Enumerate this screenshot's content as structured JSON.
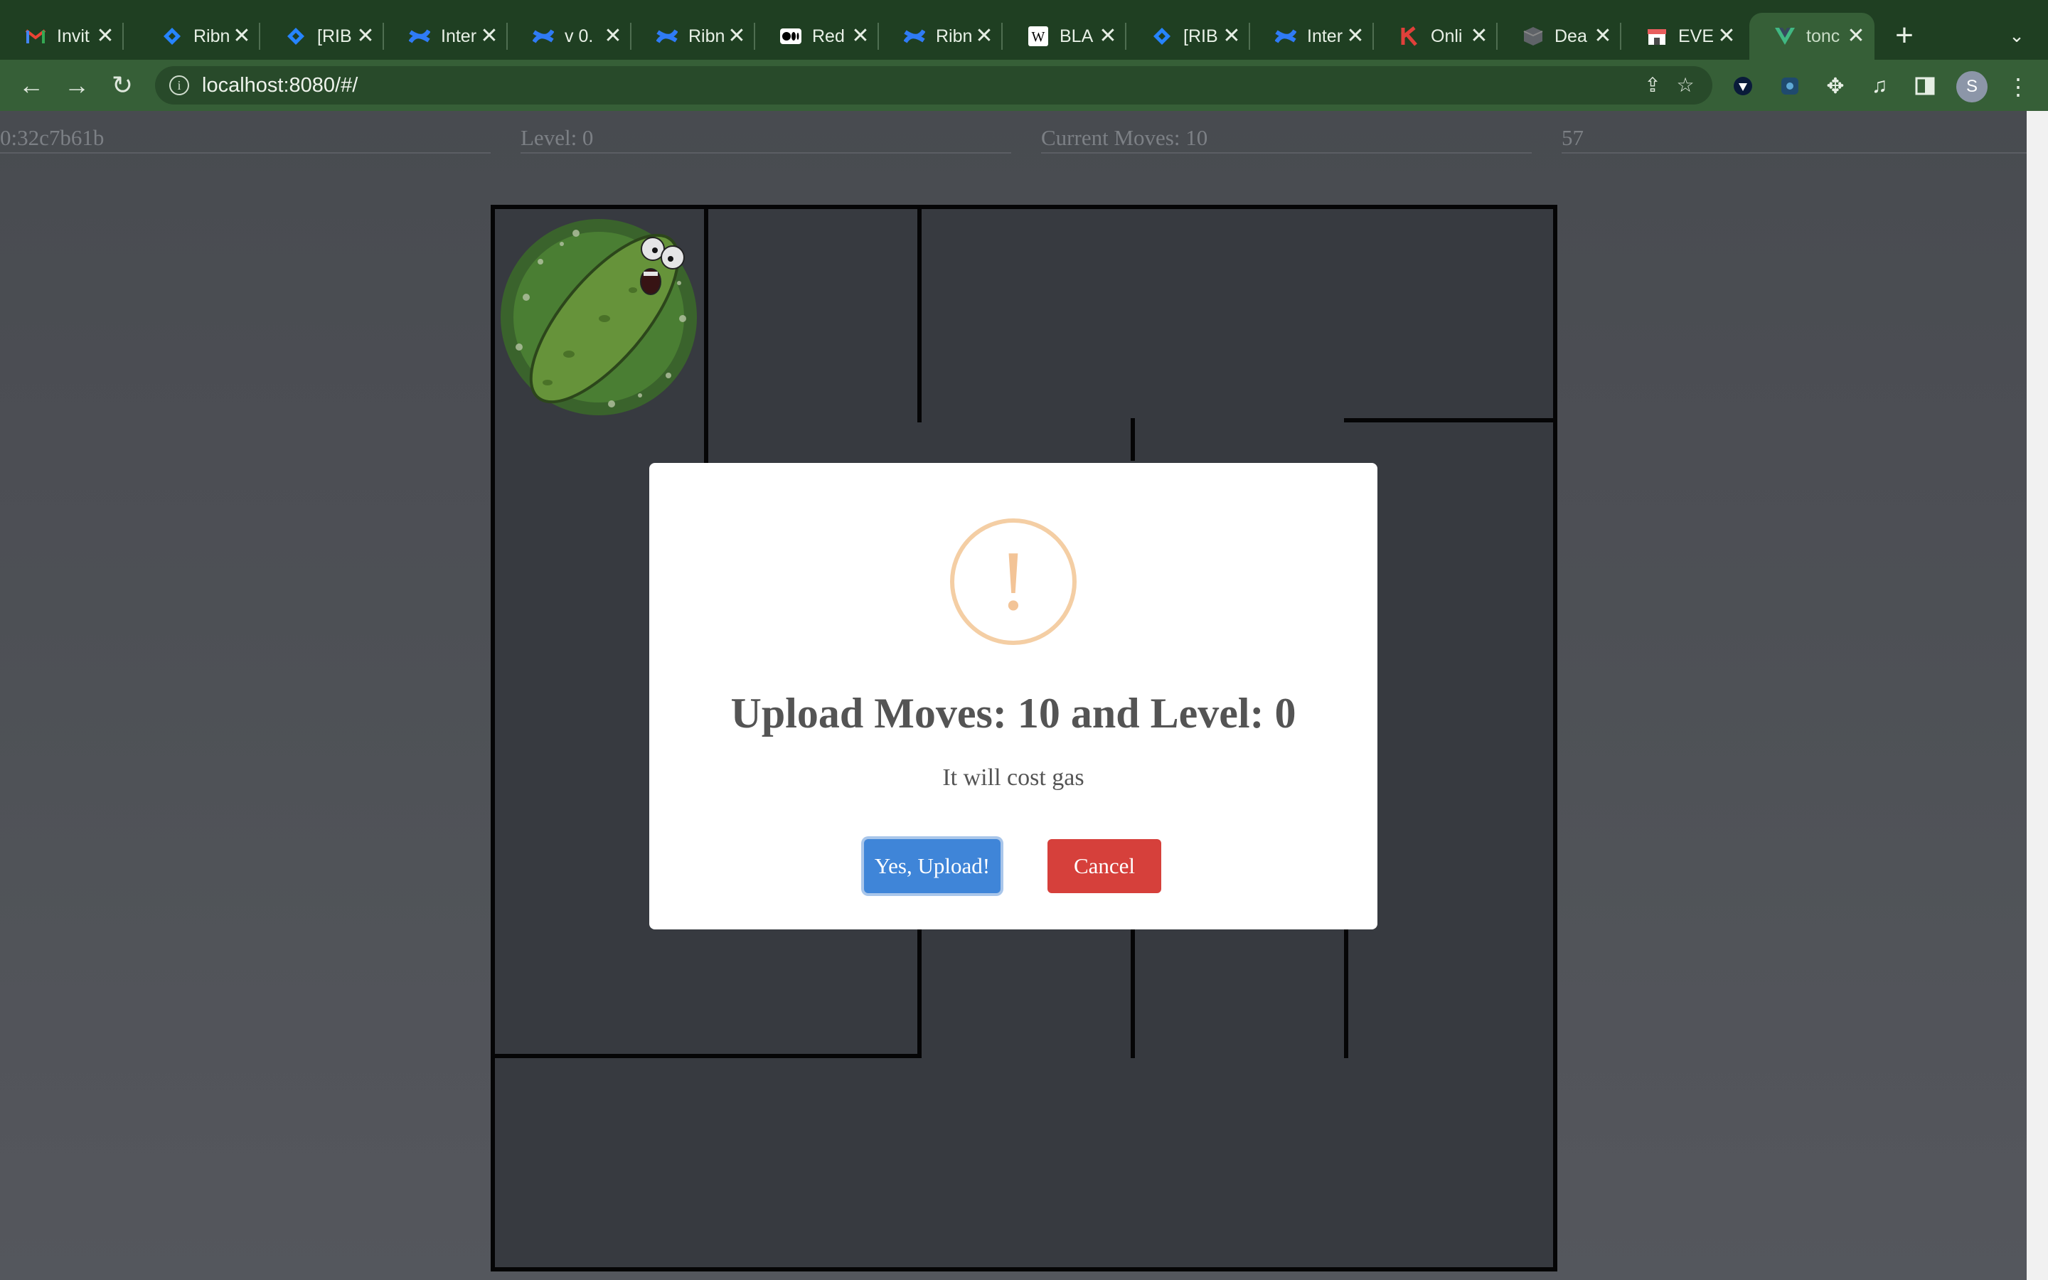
{
  "browser": {
    "tabs": [
      {
        "title": "Invit",
        "icon": "gmail-icon"
      },
      {
        "title": "Ribn",
        "icon": "jira-icon"
      },
      {
        "title": "[RIB",
        "icon": "jira-icon"
      },
      {
        "title": "Inter",
        "icon": "confluence-icon"
      },
      {
        "title": "v 0.",
        "icon": "confluence-icon"
      },
      {
        "title": "Ribn",
        "icon": "confluence-icon"
      },
      {
        "title": "Red",
        "icon": "medium-icon"
      },
      {
        "title": "Ribn",
        "icon": "confluence-icon"
      },
      {
        "title": "BLA",
        "icon": "wikipedia-icon"
      },
      {
        "title": "[RIB",
        "icon": "jira-icon"
      },
      {
        "title": "Inter",
        "icon": "confluence-icon"
      },
      {
        "title": "Onli",
        "icon": "k-icon"
      },
      {
        "title": "Dea",
        "icon": "box-icon"
      },
      {
        "title": "EVE",
        "icon": "store-icon"
      },
      {
        "title": "tonc",
        "icon": "vue-icon",
        "active": true
      }
    ],
    "url": "localhost:8080/#/",
    "profile_initial": "S"
  },
  "status_bar": {
    "address": "0:32c7b61b",
    "level": "Level: 0",
    "moves": "Current Moves: 10",
    "count": "57"
  },
  "modal": {
    "icon": "!",
    "title": "Upload Moves: 10 and Level: 0",
    "text": "It will cost gas",
    "confirm_label": "Yes, Upload!",
    "cancel_label": "Cancel"
  },
  "colors": {
    "tabbar": "#1f3f22",
    "toolbar": "#365f37",
    "maze_bg": "#3a3d42",
    "confirm": "#3f85d8",
    "cancel": "#d6403b",
    "warning": "#f4cea4"
  }
}
